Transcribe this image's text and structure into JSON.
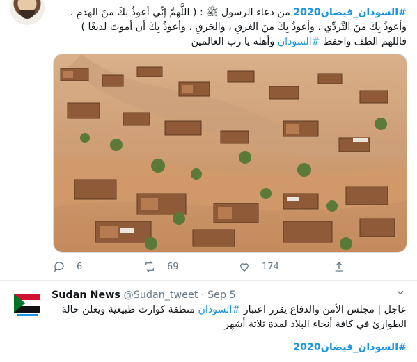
{
  "tweet1": {
    "text_lines": [
      [
        "#السودان_فيضان2020",
        " من دعاء الرسول ﷺ : ( اللَّهمَّ إنِّي أعوذُ بكَ منَ الهدمِ ،"
      ],
      "وأعوذُ بِكَ منَ التَّردِّي ، وأعوذُ بِكَ منَ الغرقِ ، والحَرقِ ، وأعوذُ بِكَ أن أموتَ لديغًا )",
      [
        "فاللهم الطف واحفظ ",
        "#السودان",
        " وأهله يا رب العالمين"
      ]
    ],
    "image_desc_icon": "flooded-village-photo",
    "actions": {
      "reply_count": "6",
      "retweet_count": "69",
      "like_count": "174"
    }
  },
  "tweet2": {
    "name": "Sudan News",
    "handle": "@Sudan_tweet",
    "separator": "·",
    "date": "Sep 5",
    "text_line1_pre": "عاجل | مجلس الأمن والدفاع يقرر اعتبار ",
    "text_line1_tag": "#السودان",
    "text_line1_post": " منطقة كوارث طبيعية ويعلن حالة",
    "text_line2": "الطوارئ في كافة أنحاء البلاد لمدة ثلاثة أشهر",
    "hashtag": "#السودان_فيضان2020"
  },
  "colors": {
    "link": "#1b95e0",
    "muted": "#657786",
    "text": "#14171a"
  }
}
